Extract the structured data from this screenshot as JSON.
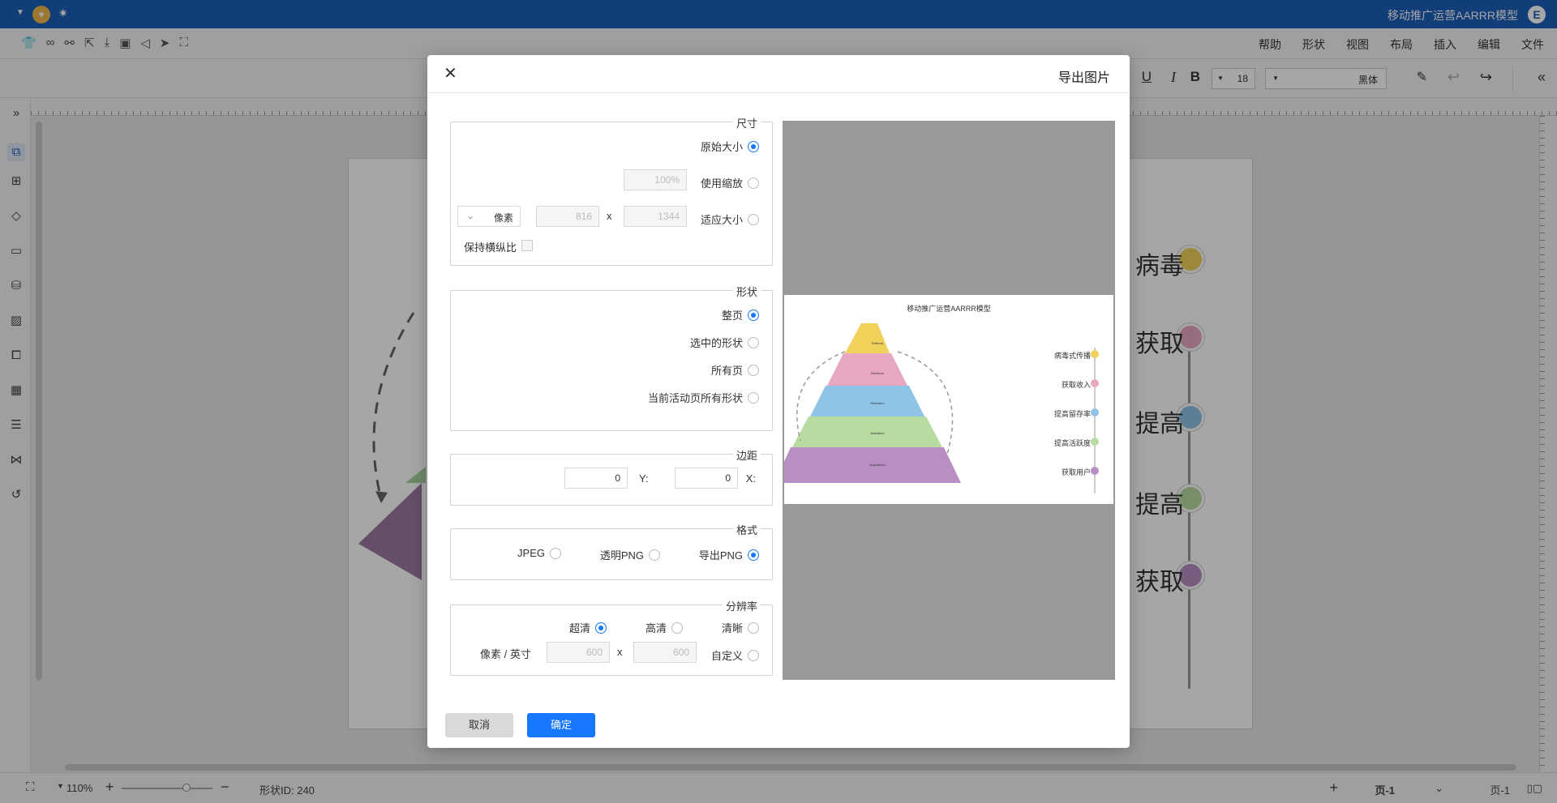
{
  "app": {
    "title": "移动推广运营AARRR模型",
    "logo": "E"
  },
  "menubar": {
    "items": [
      "文件",
      "编辑",
      "插入",
      "布局",
      "视图",
      "形状",
      "帮助"
    ]
  },
  "toolbar": {
    "font": "黑体",
    "font_size": "18",
    "bold": "B",
    "italic": "I",
    "underline": "U"
  },
  "canvas": {
    "timeline_labels": [
      "病毒",
      "获取",
      "提高",
      "提高",
      "获取"
    ],
    "timeline_colors": [
      "#f0d25a",
      "#e7a7c3",
      "#8fc4e6",
      "#b7dba0",
      "#b98fc3"
    ]
  },
  "statusbar": {
    "page_tab_left": "页-1",
    "page_tab_active": "页-1",
    "add_page": "+",
    "shape_id": "形状ID: 240",
    "zoom": "110%"
  },
  "dialog": {
    "title": "导出图片",
    "size": {
      "legend": "尺寸",
      "original": "原始大小",
      "scale": "使用缩放",
      "scale_value": "100%",
      "fit": "适应大小",
      "width": "1344",
      "height": "816",
      "x": "x",
      "unit": "像素",
      "keep_ratio": "保持横纵比"
    },
    "shape": {
      "legend": "形状",
      "whole": "整页",
      "selected": "选中的形状",
      "all": "所有页",
      "current_all": "当前活动页所有形状"
    },
    "margin": {
      "legend": "边距",
      "x_label": "X:",
      "x_value": "0",
      "y_label": "Y:",
      "y_value": "0"
    },
    "format": {
      "legend": "格式",
      "png": "导出PNG",
      "transparent_png": "透明PNG",
      "jpeg": "JPEG"
    },
    "resolution": {
      "legend": "分辨率",
      "clear": "清晰",
      "high": "高清",
      "ultra": "超清",
      "custom": "自定义",
      "w": "600",
      "h": "600",
      "x": "x",
      "unit": "像素 / 英寸"
    },
    "preview": {
      "title": "移动推广运营AARRR模型",
      "legend": [
        "病毒式传播",
        "获取收入",
        "提高留存率",
        "提高活跃度",
        "获取用户"
      ],
      "legend_colors": [
        "#f0d25a",
        "#e7a7c3",
        "#8fc4e6",
        "#b7dba0",
        "#b98fc3"
      ],
      "tiers": [
        "Referral",
        "Revenue",
        "Retention",
        "Activation",
        "Acquisition"
      ]
    },
    "ok": "确定",
    "cancel": "取消"
  }
}
